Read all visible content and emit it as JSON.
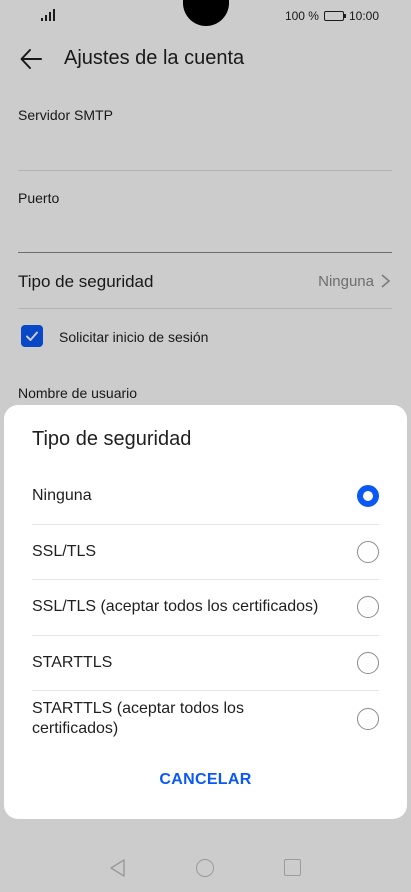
{
  "status_bar": {
    "battery_text": "100 %",
    "time": "10:00",
    "icons": [
      "signal-icon",
      "battery-icon"
    ]
  },
  "app_bar": {
    "title": "Ajustes de la cuenta",
    "back_icon": "arrow-left-icon"
  },
  "settings": {
    "smtp_label": "Servidor SMTP",
    "port_label": "Puerto",
    "security_label": "Tipo de seguridad",
    "security_value": "Ninguna",
    "login_label": "Solicitar inicio de sesión",
    "login_checked": true,
    "username_label": "Nombre de usuario"
  },
  "dialog": {
    "title": "Tipo de seguridad",
    "options": [
      {
        "label": "Ninguna",
        "selected": true
      },
      {
        "label": "SSL/TLS",
        "selected": false
      },
      {
        "label": "SSL/TLS (aceptar todos los certificados)",
        "selected": false
      },
      {
        "label": "STARTTLS",
        "selected": false
      },
      {
        "label": "STARTTLS (aceptar todos los certificados)",
        "selected": false
      }
    ],
    "cancel_label": "CANCELAR"
  },
  "nav_bar": {
    "icons": [
      "nav-back-icon",
      "nav-home-icon",
      "nav-recents-icon"
    ]
  },
  "colors": {
    "accent": "#0a59f7",
    "scrim": "rgba(0,0,0,0.2)"
  }
}
